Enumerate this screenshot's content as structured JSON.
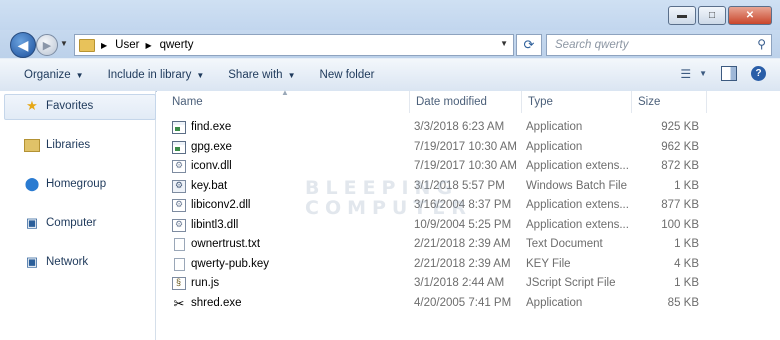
{
  "window": {
    "buttons": [
      "minimize",
      "maximize",
      "close"
    ]
  },
  "address": {
    "path": [
      "User",
      "qwerty"
    ]
  },
  "search": {
    "placeholder": "Search qwerty"
  },
  "toolbar": {
    "organize": "Organize",
    "include_in_library": "Include in library",
    "share_with": "Share with",
    "new_folder": "New folder"
  },
  "nav": {
    "favorites": "Favorites",
    "libraries": "Libraries",
    "homegroup": "Homegroup",
    "computer": "Computer",
    "network": "Network"
  },
  "columns": {
    "name": "Name",
    "date": "Date modified",
    "type": "Type",
    "size": "Size"
  },
  "files": [
    {
      "icon": "exe-icon",
      "name": "find.exe",
      "date": "3/3/2018 6:23 AM",
      "type": "Application",
      "size": "925 KB"
    },
    {
      "icon": "exe-icon",
      "name": "gpg.exe",
      "date": "7/19/2017 10:30 AM",
      "type": "Application",
      "size": "962 KB"
    },
    {
      "icon": "dll-icon",
      "name": "iconv.dll",
      "date": "7/19/2017 10:30 AM",
      "type": "Application extens...",
      "size": "872 KB"
    },
    {
      "icon": "bat-icon",
      "name": "key.bat",
      "date": "3/1/2018 5:57 PM",
      "type": "Windows Batch File",
      "size": "1 KB"
    },
    {
      "icon": "dll-icon",
      "name": "libiconv2.dll",
      "date": "3/16/2004 8:37 PM",
      "type": "Application extens...",
      "size": "877 KB"
    },
    {
      "icon": "dll-icon",
      "name": "libintl3.dll",
      "date": "10/9/2004 5:25 PM",
      "type": "Application extens...",
      "size": "100 KB"
    },
    {
      "icon": "txt-icon",
      "name": "ownertrust.txt",
      "date": "2/21/2018 2:39 AM",
      "type": "Text Document",
      "size": "1 KB"
    },
    {
      "icon": "key-file-icon",
      "name": "qwerty-pub.key",
      "date": "2/21/2018 2:39 AM",
      "type": "KEY File",
      "size": "4 KB"
    },
    {
      "icon": "js-icon",
      "name": "run.js",
      "date": "3/1/2018 2:44 AM",
      "type": "JScript Script File",
      "size": "1 KB"
    },
    {
      "icon": "shred-icon",
      "name": "shred.exe",
      "date": "4/20/2005 7:41 PM",
      "type": "Application",
      "size": "85 KB"
    }
  ],
  "watermark": {
    "line1": "BLEEPING",
    "line2": "COMPUTER"
  }
}
